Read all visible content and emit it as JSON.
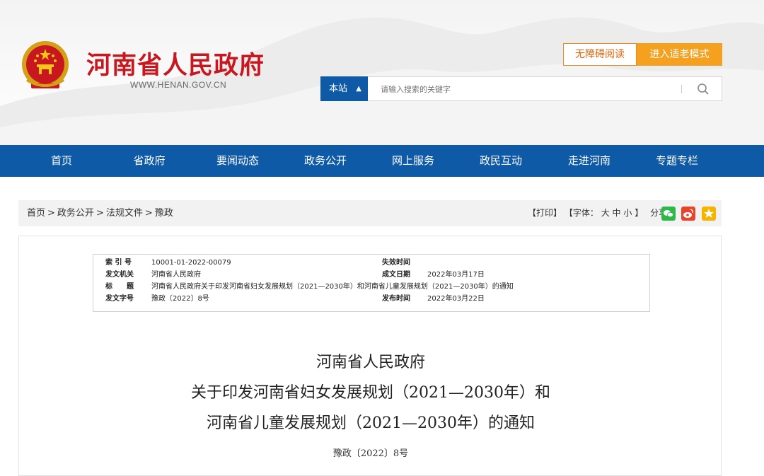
{
  "header": {
    "site_title": "河南省人民政府",
    "site_url": "WWW.HENAN.GOV.CN",
    "accessibility_label": "无障碍阅读",
    "elder_mode_label": "进入适老模式",
    "emblem_icon": "national-emblem-icon"
  },
  "search": {
    "scope_label": "本站",
    "scope_icon": "updown-arrows-icon",
    "placeholder": "请输入搜索的关键字",
    "button_icon": "search-icon"
  },
  "nav": {
    "items": [
      {
        "label": "首页"
      },
      {
        "label": "省政府"
      },
      {
        "label": "要闻动态"
      },
      {
        "label": "政务公开"
      },
      {
        "label": "网上服务"
      },
      {
        "label": "政民互动"
      },
      {
        "label": "走进河南"
      },
      {
        "label": "专题专栏"
      }
    ]
  },
  "breadcrumb": {
    "items": [
      "首页",
      "政务公开",
      "法规文件",
      "豫政"
    ],
    "separator": ">"
  },
  "tools": {
    "print": "【打印】",
    "font_label": "【字体：",
    "font_large": "大",
    "font_medium": "中",
    "font_small": "小",
    "font_end": "】",
    "share_label": "分享：",
    "share_icons": [
      "wechat-icon",
      "weibo-icon",
      "favorite-star-icon"
    ]
  },
  "meta": {
    "index_key": "索 引 号",
    "index_val": "10001-01-2022-00079",
    "expire_key": "失效时间",
    "expire_val": "",
    "issuer_key": "发文机关",
    "issuer_val": "河南省人民政府",
    "created_key": "成文日期",
    "created_val": "2022年03月17日",
    "title_key": "标　　题",
    "title_val": "河南省人民政府关于印发河南省妇女发展规划（2021—2030年）和河南省儿童发展规划（2021—2030年）的通知",
    "docno_key": "发文字号",
    "docno_val": "豫政〔2022〕8号",
    "published_key": "发布时间",
    "published_val": "2022年03月22日"
  },
  "document": {
    "title_line1": "河南省人民政府",
    "title_line2": "关于印发河南省妇女发展规划（2021—2030年）和",
    "title_line3": "河南省儿童发展规划（2021—2030年）的通知",
    "doc_number": "豫政〔2022〕8号"
  },
  "colors": {
    "brand_red": "#c8171e",
    "nav_blue": "#0f5aa7",
    "accent_orange": "#f5a01f",
    "wechat_green": "#2fb84a",
    "weibo_red": "#e8442a",
    "star_yellow": "#f4b400"
  }
}
